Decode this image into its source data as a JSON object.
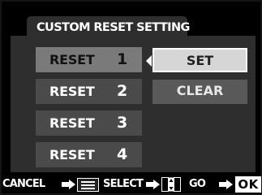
{
  "title": "CUSTOM RESET SETTING",
  "reset_items": [
    {
      "label": "RESET",
      "number": "1"
    },
    {
      "label": "RESET",
      "number": "2"
    },
    {
      "label": "RESET",
      "number": "3"
    },
    {
      "label": "RESET",
      "number": "4"
    }
  ],
  "options": {
    "set": "SET",
    "clear": "CLEAR"
  },
  "footer": {
    "cancel": "CANCEL",
    "select": "SELECT",
    "go": "GO",
    "ok": "OK"
  },
  "icons": {
    "arrow": "right-arrow-icon",
    "menu": "menu-icon",
    "dpad": "dpad-up-down-icon",
    "submenu_arrow": "left-chevron-icon"
  },
  "colors": {
    "background": "#000000",
    "panel": "#2e2e2e",
    "item": "#4a4a4a",
    "item_selected": "#7a7a7a",
    "option_selected": "#d6d6d6",
    "option": "#595959"
  }
}
